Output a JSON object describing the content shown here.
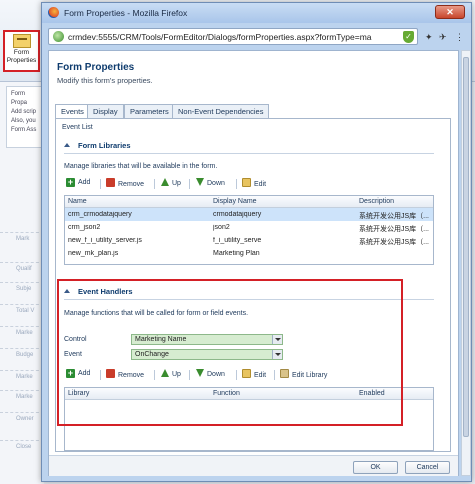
{
  "background": {
    "form_properties_button": "Form Properties",
    "popup_lines": [
      "Form Propa",
      "Add scrip",
      "Also, you",
      "Form Ass"
    ],
    "left_placeholders": [
      "Mark",
      "Qualif",
      "Subje",
      "Total V",
      "Marke",
      "Budge",
      "Marke",
      "Marke",
      "Owner",
      "Close"
    ]
  },
  "window": {
    "title": "Form Properties - Mozilla Firefox",
    "url": "crmdev:5555/CRM/Tools/FormEditor/Dialogs/formProperties.aspx?formType=ma"
  },
  "dialog": {
    "title": "Form Properties",
    "subtitle": "Modify this form's properties.",
    "tabs": [
      "Events",
      "Display",
      "Parameters",
      "Non-Event Dependencies"
    ],
    "event_list_label": "Event List"
  },
  "form_libraries": {
    "heading": "Form Libraries",
    "description": "Manage libraries that will be available in the form.",
    "toolbar": {
      "add": "Add",
      "remove": "Remove",
      "up": "Up",
      "down": "Down",
      "edit": "Edit"
    },
    "columns": [
      "Name",
      "Display Name",
      "Description"
    ],
    "rows": [
      {
        "name": "crm_crmodatajquery",
        "display": "crmodatajquery",
        "description": "系统开发公用JS库（..."
      },
      {
        "name": "crm_json2",
        "display": "json2",
        "description": "系统开发公用JS库（..."
      },
      {
        "name": "new_f_i_utility_server.js",
        "display": "f_i_utility_serve",
        "description": "系统开发公用JS库（..."
      },
      {
        "name": "new_mk_plan.js",
        "display": "Marketing Plan",
        "description": ""
      }
    ]
  },
  "event_handlers": {
    "heading": "Event Handlers",
    "description": "Manage functions that will be called for form or field events.",
    "control_label": "Control",
    "control_value": "Marketing Name",
    "event_label": "Event",
    "event_value": "OnChange",
    "toolbar": {
      "add": "Add",
      "remove": "Remove",
      "up": "Up",
      "down": "Down",
      "edit": "Edit",
      "edit_library": "Edit Library"
    },
    "columns": [
      "Library",
      "Function",
      "Enabled"
    ]
  },
  "footer": {
    "ok": "OK",
    "cancel": "Cancel"
  },
  "colors": {
    "highlight_red": "#d42026",
    "selected_row": "#cde3fa",
    "select_green": "#d6ecd0"
  }
}
